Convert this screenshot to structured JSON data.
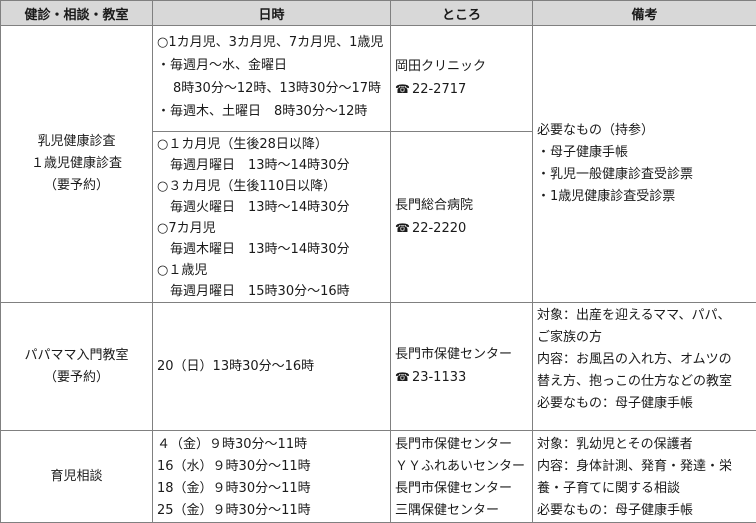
{
  "header": {
    "col1": "健診・相談・教室",
    "col2": "日時",
    "col3": "ところ",
    "col4": "備考"
  },
  "row1": {
    "category": [
      "乳児健康診査",
      "１歳児健康診査",
      "（要予約）"
    ],
    "sub1": {
      "datetime": [
        "○1カ月児、3カ月児、7カ月児、1歳児",
        "・毎週月～水、金曜日",
        "8時30分～12時、13時30分～17時",
        "・毎週木、土曜日　8時30分～12時"
      ],
      "place": "岡田クリニック",
      "phone_icon": "phone-icon",
      "phone": "22-2717"
    },
    "sub2": {
      "datetime": [
        "○１カ月児（生後28日以降）",
        "毎週月曜日　13時～14時30分",
        "○３カ月児（生後110日以降）",
        "毎週火曜日　13時～14時30分",
        "○7カ月児",
        "毎週木曜日　13時～14時30分",
        "○１歳児",
        "毎週月曜日　15時30分～16時"
      ],
      "place": "長門総合病院",
      "phone_icon": "phone-icon",
      "phone": "22-2220"
    },
    "notes": [
      "必要なもの（持参）",
      "・母子健康手帳",
      "・乳児一般健康診査受診票",
      "・1歳児健康診査受診票"
    ]
  },
  "row2": {
    "category": [
      "パパママ入門教室",
      "（要予約）"
    ],
    "datetime": "20（日）13時30分～16時",
    "place": "長門市保健センター",
    "phone_icon": "phone-icon",
    "phone": "23-1133",
    "notes": [
      "対象：出産を迎えるママ、パパ、",
      "ご家族の方",
      "内容：お風呂の入れ方、オムツの",
      "替え方、抱っこの仕方などの教室",
      "必要なもの：母子健康手帳"
    ]
  },
  "row3": {
    "category": [
      "育児相談"
    ],
    "datetime": [
      "４（金）９時30分～11時",
      "16（水）９時30分～11時",
      "18（金）９時30分～11時",
      "25（金）９時30分～11時"
    ],
    "places": [
      "長門市保健センター",
      "ＹＹふれあいセンター",
      "長門市保健センター",
      "三隅保健センター"
    ],
    "notes": [
      "対象：乳幼児とその保護者",
      "内容：身体計測、発育・発達・栄",
      "養・子育てに関する相談",
      "必要なもの：母子健康手帳"
    ]
  }
}
